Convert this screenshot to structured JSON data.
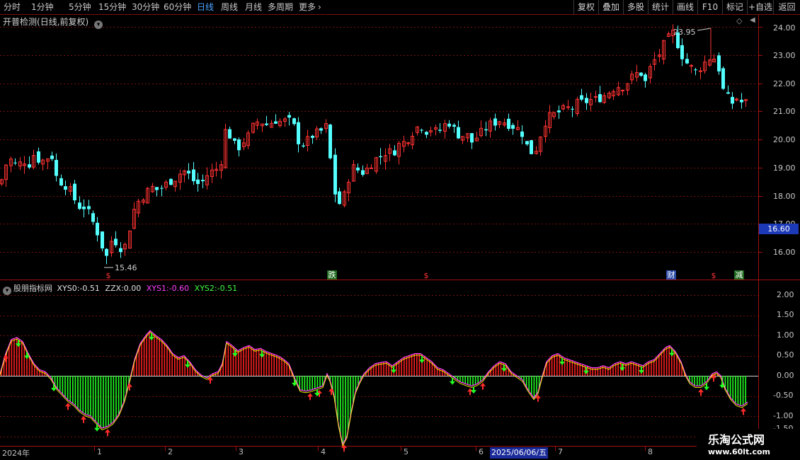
{
  "toolbar": {
    "periods": [
      "分时",
      "1分钟",
      "5分钟",
      "15分钟",
      "30分钟",
      "60分钟",
      "日线",
      "周线",
      "月线",
      "多周期",
      "更多"
    ],
    "active_period": "日线",
    "actions": [
      "复权",
      "叠加",
      "多股",
      "统计",
      "画线",
      "F10",
      "标记",
      "+自选",
      "返回"
    ]
  },
  "main_chart": {
    "title": "开普检测",
    "title_sub": "(日线,前复权)",
    "high_label": "23.95",
    "low_label": "15.46",
    "last_price": "16.60",
    "price_axis": [
      "24.00",
      "23.00",
      "22.00",
      "21.00",
      "20.00",
      "19.00",
      "18.00",
      "17.00",
      "16.00"
    ],
    "markers": [
      {
        "text": "$",
        "type": "dollar"
      },
      {
        "text": "跌",
        "type": "down"
      },
      {
        "text": "$",
        "type": "dollar"
      },
      {
        "text": "财",
        "type": "finance"
      },
      {
        "text": "$",
        "type": "dollar"
      },
      {
        "text": "减",
        "type": "reduce"
      }
    ]
  },
  "indicator": {
    "name": "股朋指标网",
    "xys0_label": "XYS0:",
    "xys0_value": "-0.51",
    "zzx_label": "ZZX:",
    "zzx_value": "0.00",
    "xys1_label": "XYS1:",
    "xys1_value": "-0.60",
    "xys2_label": "XYS2:",
    "xys2_value": "-0.51",
    "axis": [
      "2.00",
      "1.50",
      "1.00",
      "0.50",
      "0.00",
      "-0.50",
      "-1.00",
      "-1.50"
    ]
  },
  "x_axis": {
    "labels": [
      "2024年",
      "1",
      "2",
      "3",
      "4",
      "5",
      "6",
      "7",
      "8"
    ],
    "current_date": "2025/06/06/五"
  },
  "watermark": {
    "title": "乐淘公式网",
    "url": "www.60lt.com"
  },
  "colors": {
    "up": "#ff3232",
    "down": "#54ffff",
    "hist_pos": "#ff2020",
    "hist_neg": "#22ff22",
    "xys1": "#ff40ff",
    "xys2": "#ffff00",
    "grid": "#7a1010",
    "price_box": "#1c3ab8"
  },
  "chart_data": [
    {
      "type": "candlestick",
      "title": "开普检测(日线,前复权)",
      "ylim": [
        15.2,
        24.5
      ],
      "x_tick_labels": [
        "2024年",
        "1",
        "2",
        "3",
        "4",
        "5",
        "6",
        "7",
        "8"
      ],
      "annotations": [
        {
          "text": "23.95",
          "kind": "high"
        },
        {
          "text": "15.46",
          "kind": "low"
        }
      ],
      "path": [
        [
          0,
          18.4
        ],
        [
          8,
          19.1
        ],
        [
          16,
          19.3
        ],
        [
          24,
          19.0
        ],
        [
          32,
          19.3
        ],
        [
          40,
          19.1
        ],
        [
          48,
          19.5
        ],
        [
          56,
          19.2
        ],
        [
          64,
          19.3
        ],
        [
          72,
          19.5
        ],
        [
          80,
          18.6
        ],
        [
          96,
          18.3
        ],
        [
          104,
          17.9
        ],
        [
          112,
          17.6
        ],
        [
          120,
          17.6
        ],
        [
          128,
          17.2
        ],
        [
          136,
          16.8
        ],
        [
          144,
          16.2
        ],
        [
          150,
          15.8
        ],
        [
          158,
          16.5
        ],
        [
          166,
          16.3
        ],
        [
          174,
          16.0
        ],
        [
          182,
          16.8
        ],
        [
          190,
          17.6
        ],
        [
          198,
          17.9
        ],
        [
          206,
          18.1
        ],
        [
          214,
          18.3
        ],
        [
          222,
          18.2
        ],
        [
          230,
          18.3
        ],
        [
          238,
          18.5
        ],
        [
          246,
          18.6
        ],
        [
          254,
          18.8
        ],
        [
          262,
          18.9
        ],
        [
          270,
          18.6
        ],
        [
          278,
          18.4
        ],
        [
          286,
          18.5
        ],
        [
          294,
          18.8
        ],
        [
          302,
          18.9
        ],
        [
          310,
          19.0
        ],
        [
          318,
          20.3
        ],
        [
          326,
          20.1
        ],
        [
          334,
          19.6
        ],
        [
          342,
          19.9
        ],
        [
          350,
          20.1
        ],
        [
          358,
          20.5
        ],
        [
          366,
          20.7
        ],
        [
          374,
          20.5
        ],
        [
          382,
          20.6
        ],
        [
          390,
          20.7
        ],
        [
          398,
          20.6
        ],
        [
          406,
          20.7
        ],
        [
          414,
          20.5
        ],
        [
          422,
          19.9
        ],
        [
          430,
          19.8
        ],
        [
          438,
          20.1
        ],
        [
          446,
          20.2
        ],
        [
          454,
          20.3
        ],
        [
          462,
          20.5
        ],
        [
          470,
          18.3
        ],
        [
          478,
          17.7
        ],
        [
          484,
          17.8
        ],
        [
          490,
          18.5
        ],
        [
          498,
          19.0
        ],
        [
          506,
          18.9
        ],
        [
          514,
          18.8
        ],
        [
          522,
          19.1
        ],
        [
          530,
          19.3
        ],
        [
          538,
          19.4
        ],
        [
          546,
          19.6
        ],
        [
          554,
          19.5
        ],
        [
          562,
          19.8
        ],
        [
          570,
          19.9
        ],
        [
          578,
          20.1
        ],
        [
          586,
          20.4
        ],
        [
          594,
          20.5
        ],
        [
          602,
          20.3
        ],
        [
          610,
          20.4
        ],
        [
          618,
          20.2
        ],
        [
          626,
          20.5
        ],
        [
          634,
          20.6
        ],
        [
          642,
          20.3
        ],
        [
          650,
          20.1
        ],
        [
          658,
          20.2
        ],
        [
          666,
          19.9
        ],
        [
          674,
          20.1
        ],
        [
          682,
          20.3
        ],
        [
          690,
          20.5
        ],
        [
          698,
          20.6
        ],
        [
          706,
          20.7
        ],
        [
          714,
          20.6
        ],
        [
          722,
          20.5
        ],
        [
          730,
          20.4
        ],
        [
          738,
          20.2
        ],
        [
          746,
          19.6
        ],
        [
          754,
          19.5
        ],
        [
          760,
          19.9
        ],
        [
          768,
          20.6
        ],
        [
          776,
          20.8
        ],
        [
          784,
          20.9
        ],
        [
          792,
          21.0
        ],
        [
          800,
          21.1
        ],
        [
          808,
          21.1
        ],
        [
          816,
          21.3
        ],
        [
          824,
          21.3
        ],
        [
          832,
          21.4
        ],
        [
          840,
          21.4
        ],
        [
          848,
          21.5
        ],
        [
          856,
          21.6
        ],
        [
          864,
          21.8
        ],
        [
          872,
          21.9
        ],
        [
          880,
          21.9
        ],
        [
          888,
          22.1
        ],
        [
          896,
          22.3
        ],
        [
          904,
          22.4
        ],
        [
          912,
          22.0
        ],
        [
          920,
          22.7
        ],
        [
          928,
          22.9
        ],
        [
          936,
          23.3
        ],
        [
          944,
          23.6
        ],
        [
          950,
          23.8
        ],
        [
          958,
          23.3
        ],
        [
          966,
          22.8
        ],
        [
          974,
          22.6
        ],
        [
          982,
          22.4
        ],
        [
          990,
          22.6
        ],
        [
          998,
          22.8
        ],
        [
          1006,
          23.0
        ],
        [
          1014,
          22.6
        ],
        [
          1020,
          21.8
        ],
        [
          1026,
          21.5
        ],
        [
          1034,
          21.3
        ],
        [
          1042,
          21.5
        ],
        [
          1050,
          21.2
        ],
        [
          1056,
          21.4
        ]
      ]
    },
    {
      "type": "bar",
      "title": "股朋指标网",
      "ylim": [
        -1.7,
        2.3
      ],
      "series_names": [
        "XYS0",
        "XYS1",
        "XYS2"
      ],
      "series_values_last": {
        "XYS0": -0.51,
        "ZZX": 0.0,
        "XYS1": -0.6,
        "XYS2": -0.51
      },
      "path": [
        [
          0,
          0.05
        ],
        [
          8,
          0.55
        ],
        [
          16,
          0.9
        ],
        [
          24,
          0.95
        ],
        [
          32,
          0.85
        ],
        [
          40,
          0.55
        ],
        [
          48,
          0.3
        ],
        [
          56,
          0.15
        ],
        [
          64,
          0.1
        ],
        [
          72,
          -0.05
        ],
        [
          80,
          -0.3
        ],
        [
          88,
          -0.45
        ],
        [
          96,
          -0.6
        ],
        [
          104,
          -0.7
        ],
        [
          112,
          -0.85
        ],
        [
          120,
          -0.95
        ],
        [
          128,
          -1.0
        ],
        [
          136,
          -1.15
        ],
        [
          144,
          -1.3
        ],
        [
          152,
          -1.25
        ],
        [
          160,
          -1.15
        ],
        [
          168,
          -0.95
        ],
        [
          176,
          -0.6
        ],
        [
          184,
          -0.05
        ],
        [
          190,
          0.4
        ],
        [
          198,
          0.8
        ],
        [
          206,
          1.0
        ],
        [
          212,
          1.12
        ],
        [
          220,
          1.0
        ],
        [
          228,
          0.9
        ],
        [
          236,
          0.75
        ],
        [
          244,
          0.55
        ],
        [
          252,
          0.45
        ],
        [
          260,
          0.5
        ],
        [
          268,
          0.35
        ],
        [
          276,
          0.15
        ],
        [
          284,
          0.02
        ],
        [
          292,
          -0.05
        ],
        [
          300,
          0.05
        ],
        [
          308,
          0.1
        ],
        [
          314,
          0.3
        ],
        [
          320,
          0.85
        ],
        [
          328,
          0.75
        ],
        [
          336,
          0.62
        ],
        [
          344,
          0.7
        ],
        [
          352,
          0.75
        ],
        [
          360,
          0.65
        ],
        [
          368,
          0.68
        ],
        [
          376,
          0.6
        ],
        [
          384,
          0.55
        ],
        [
          392,
          0.5
        ],
        [
          400,
          0.42
        ],
        [
          408,
          0.3
        ],
        [
          416,
          -0.05
        ],
        [
          424,
          -0.35
        ],
        [
          432,
          -0.38
        ],
        [
          440,
          -0.35
        ],
        [
          448,
          -0.3
        ],
        [
          456,
          -0.25
        ],
        [
          462,
          0.05
        ],
        [
          466,
          -0.1
        ],
        [
          472,
          -0.5
        ],
        [
          478,
          -1.2
        ],
        [
          484,
          -1.7
        ],
        [
          490,
          -1.5
        ],
        [
          496,
          -0.9
        ],
        [
          502,
          -0.4
        ],
        [
          508,
          -0.15
        ],
        [
          514,
          0.05
        ],
        [
          522,
          0.2
        ],
        [
          530,
          0.3
        ],
        [
          538,
          0.33
        ],
        [
          546,
          0.35
        ],
        [
          554,
          0.25
        ],
        [
          562,
          0.35
        ],
        [
          570,
          0.45
        ],
        [
          578,
          0.5
        ],
        [
          586,
          0.55
        ],
        [
          594,
          0.55
        ],
        [
          602,
          0.45
        ],
        [
          610,
          0.35
        ],
        [
          618,
          0.2
        ],
        [
          626,
          0.15
        ],
        [
          634,
          0.05
        ],
        [
          642,
          -0.05
        ],
        [
          650,
          -0.15
        ],
        [
          658,
          -0.2
        ],
        [
          666,
          -0.25
        ],
        [
          674,
          -0.2
        ],
        [
          682,
          -0.1
        ],
        [
          690,
          0.1
        ],
        [
          698,
          0.25
        ],
        [
          706,
          0.35
        ],
        [
          714,
          0.3
        ],
        [
          722,
          0.1
        ],
        [
          730,
          0.0
        ],
        [
          738,
          -0.1
        ],
        [
          746,
          -0.35
        ],
        [
          754,
          -0.55
        ],
        [
          760,
          -0.4
        ],
        [
          766,
          0.0
        ],
        [
          772,
          0.35
        ],
        [
          780,
          0.5
        ],
        [
          788,
          0.55
        ],
        [
          796,
          0.45
        ],
        [
          804,
          0.4
        ],
        [
          812,
          0.35
        ],
        [
          820,
          0.3
        ],
        [
          828,
          0.25
        ],
        [
          836,
          0.2
        ],
        [
          844,
          0.2
        ],
        [
          852,
          0.25
        ],
        [
          860,
          0.2
        ],
        [
          868,
          0.3
        ],
        [
          876,
          0.35
        ],
        [
          884,
          0.3
        ],
        [
          892,
          0.35
        ],
        [
          900,
          0.3
        ],
        [
          908,
          0.25
        ],
        [
          916,
          0.35
        ],
        [
          924,
          0.4
        ],
        [
          932,
          0.55
        ],
        [
          940,
          0.7
        ],
        [
          946,
          0.75
        ],
        [
          954,
          0.6
        ],
        [
          962,
          0.35
        ],
        [
          968,
          0.05
        ],
        [
          974,
          -0.15
        ],
        [
          982,
          -0.25
        ],
        [
          990,
          -0.25
        ],
        [
          998,
          -0.15
        ],
        [
          1006,
          0.05
        ],
        [
          1012,
          0.1
        ],
        [
          1018,
          0.0
        ],
        [
          1024,
          -0.3
        ],
        [
          1032,
          -0.55
        ],
        [
          1040,
          -0.7
        ],
        [
          1048,
          -0.75
        ],
        [
          1056,
          -0.65
        ]
      ]
    }
  ]
}
